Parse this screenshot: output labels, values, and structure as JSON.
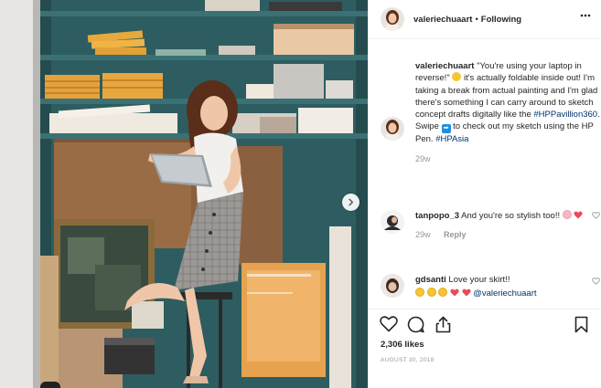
{
  "header": {
    "username": "valeriechuaart",
    "separator": "•",
    "follow_status": "Following"
  },
  "caption": {
    "username": "valeriechuaart",
    "text_part1": "\"You're using your laptop in reverse!\"",
    "text_part2": "it's actually foldable inside out! I'm taking a break from actual painting and I'm glad there's something I can carry around to sketch concept drafts digitally like the",
    "hashtag1": "#HPPavillion360",
    "text_part3": ". Swipe",
    "text_part4": "to check out my sketch using the HP Pen.",
    "hashtag2": "#HPAsia",
    "age": "29w"
  },
  "comments": [
    {
      "username": "tanpopo_3",
      "text": "And you're so stylish too!!",
      "age": "29w",
      "reply_label": "Reply"
    },
    {
      "username": "gdsanti",
      "text": "Love your skirt!!",
      "mention": "@valeriechuaart"
    }
  ],
  "post": {
    "likes": "2,306 likes",
    "date": "AUGUST 30, 2018"
  },
  "icons": {
    "more": "more-options-icon",
    "next": "chevron-right-icon",
    "like": "heart-outline-icon",
    "comment": "comment-bubble-icon",
    "share": "share-icon",
    "save": "bookmark-icon"
  },
  "colors": {
    "username": "#262626",
    "hashtag": "#003569",
    "secondary": "#999999",
    "heart_red": "#ed4956"
  }
}
